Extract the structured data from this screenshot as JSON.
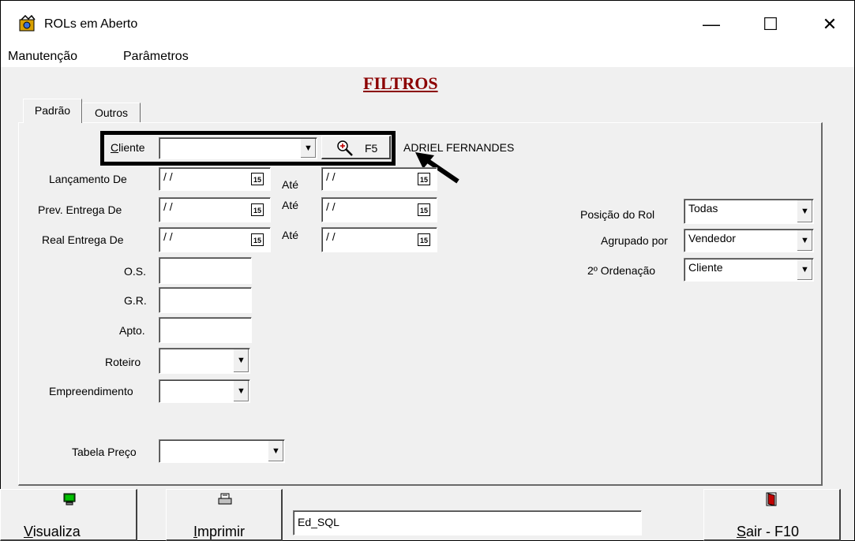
{
  "window": {
    "title": "ROLs em Aberto",
    "minimize_glyph": "—",
    "maximize_glyph": "☐",
    "close_glyph": "✕"
  },
  "menu": [
    "Manutenção",
    "Parâmetros"
  ],
  "heading": "FILTROS",
  "tabs": [
    "Padrão",
    "Outros"
  ],
  "filters": {
    "cliente": {
      "label": "Cliente",
      "value": "",
      "search_label": "F5",
      "selected_name": "ADRIEL FERNANDES"
    },
    "lancamento": {
      "label": "Lançamento De",
      "from": "/ /",
      "to_label": "Até",
      "to": "/ /"
    },
    "prev_entrega": {
      "label": "Prev. Entrega De",
      "from": "/ /",
      "to_label": "Até",
      "to": "/ /"
    },
    "real_entrega": {
      "label": "Real Entrega De",
      "from": "/ /",
      "to_label": "Até",
      "to": "/ /"
    },
    "os": {
      "label": "O.S.",
      "value": ""
    },
    "gr": {
      "label": "G.R.",
      "value": ""
    },
    "apto": {
      "label": "Apto.",
      "value": ""
    },
    "roteiro": {
      "label": "Roteiro",
      "value": ""
    },
    "empreendimento": {
      "label": "Empreendimento",
      "value": ""
    },
    "tabela_preco": {
      "label": "Tabela Preço",
      "value": ""
    },
    "posicao_rol": {
      "label": "Posição do Rol",
      "value": "Todas"
    },
    "agrupado_por": {
      "label": "Agrupado por",
      "value": "Vendedor"
    },
    "ordenacao": {
      "label": "2º Ordenação",
      "value": "Cliente"
    }
  },
  "calendar_glyph": "15",
  "dropdown_glyph": "▼",
  "bottom": {
    "visualiza": "Visualiza",
    "imprimir": "Imprimir",
    "sql_field": "Ed_SQL",
    "sair": "Sair - F10"
  },
  "colors": {
    "heading": "#8b0000",
    "background": "#f0f0f0"
  }
}
